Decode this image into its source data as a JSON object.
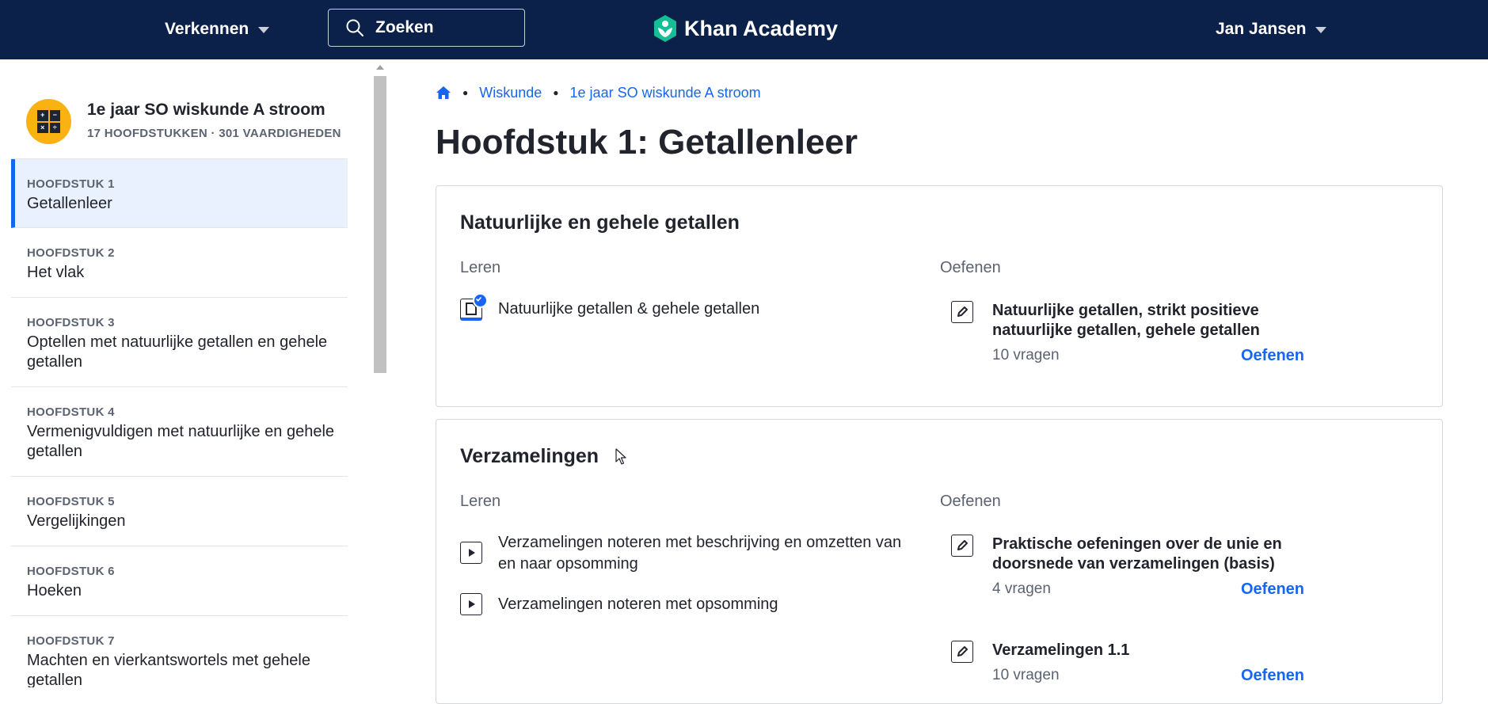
{
  "topbar": {
    "explore_label": "Verkennen",
    "search_placeholder": "Zoeken",
    "logo_text": "Khan Academy",
    "user_name": "Jan Jansen",
    "bg_color": "#0b2149"
  },
  "sidebar": {
    "course_title": "1e jaar SO wiskunde A stroom",
    "course_meta": "17 HOOFDSTUKKEN · 301 VAARDIGHEDEN",
    "units": [
      {
        "label": "HOOFDSTUK 1",
        "title": "Getallenleer",
        "active": true
      },
      {
        "label": "HOOFDSTUK 2",
        "title": "Het vlak"
      },
      {
        "label": "HOOFDSTUK 3",
        "title": "Optellen met natuurlijke getallen en gehele getallen"
      },
      {
        "label": "HOOFDSTUK 4",
        "title": "Vermenigvuldigen met natuurlijke en gehele getallen"
      },
      {
        "label": "HOOFDSTUK 5",
        "title": "Vergelijkingen"
      },
      {
        "label": "HOOFDSTUK 6",
        "title": "Hoeken"
      },
      {
        "label": "HOOFDSTUK 7",
        "title": "Machten en vierkantswortels met gehele getallen"
      }
    ]
  },
  "breadcrumb": {
    "home_icon": "home-icon",
    "items": [
      "Wiskunde",
      "1e jaar SO wiskunde A stroom"
    ]
  },
  "main": {
    "title": "Hoofdstuk 1: Getallenleer",
    "sections": [
      {
        "title": "Natuurlijke en gehele getallen",
        "learn_header": "Leren",
        "practice_header": "Oefenen",
        "learn_items": [
          {
            "type": "article",
            "label": "Natuurlijke getallen & gehele getallen",
            "completed": true
          }
        ],
        "practice_items": [
          {
            "title": "Natuurlijke getallen, strikt positieve natuurlijke getallen, gehele getallen",
            "count": "10 vragen",
            "action": "Oefenen"
          }
        ]
      },
      {
        "title": "Verzamelingen",
        "learn_header": "Leren",
        "practice_header": "Oefenen",
        "learn_items": [
          {
            "type": "video",
            "label": "Verzamelingen noteren met beschrijving en omzetten van en naar opsomming"
          },
          {
            "type": "video",
            "label": "Verzamelingen noteren met opsomming"
          }
        ],
        "practice_items": [
          {
            "title": "Praktische oefeningen over de unie en doorsnede van verzamelingen (basis)",
            "count": "4 vragen",
            "action": "Oefenen"
          },
          {
            "title": "Verzamelingen 1.1",
            "count": "10 vragen",
            "action": "Oefenen"
          }
        ]
      }
    ]
  },
  "colors": {
    "accent": "#1865f2",
    "active_bg": "#eaf1fe",
    "logo_green": "#14bf96",
    "course_icon_bg": "#f9b212"
  }
}
